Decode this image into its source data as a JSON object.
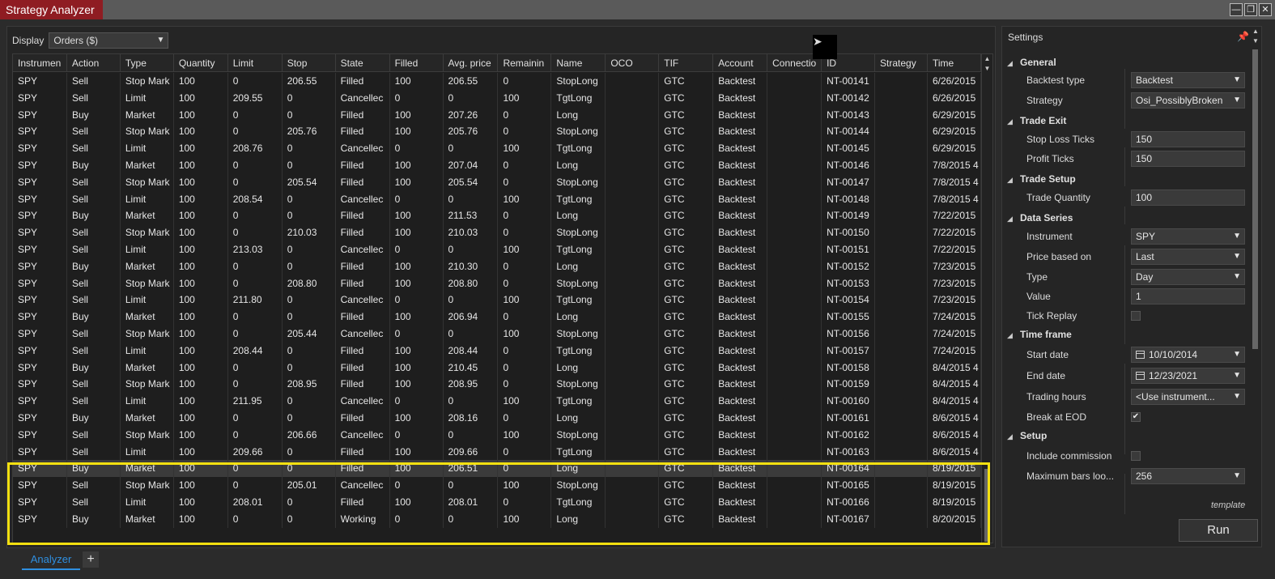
{
  "window": {
    "title": "Strategy Analyzer",
    "controls": {
      "minimize": "—",
      "restore": "❐",
      "close": "✕"
    }
  },
  "display": {
    "label": "Display",
    "selected": "Orders ($)"
  },
  "grid": {
    "columns": [
      "Instrumen",
      "Action",
      "Type",
      "Quantity",
      "Limit",
      "Stop",
      "State",
      "Filled",
      "Avg. price",
      "Remainin",
      "Name",
      "OCO",
      "TIF",
      "Account",
      "Connectio",
      "ID",
      "Strategy",
      "Time"
    ],
    "rows": [
      [
        "SPY",
        "Sell",
        "Stop Mark",
        "100",
        "0",
        "206.55",
        "Filled",
        "100",
        "206.55",
        "0",
        "StopLong",
        "",
        "GTC",
        "Backtest",
        "",
        "NT-00141",
        "",
        "6/26/2015"
      ],
      [
        "SPY",
        "Sell",
        "Limit",
        "100",
        "209.55",
        "0",
        "Cancellec",
        "0",
        "0",
        "100",
        "TgtLong",
        "",
        "GTC",
        "Backtest",
        "",
        "NT-00142",
        "",
        "6/26/2015"
      ],
      [
        "SPY",
        "Buy",
        "Market",
        "100",
        "0",
        "0",
        "Filled",
        "100",
        "207.26",
        "0",
        "Long",
        "",
        "GTC",
        "Backtest",
        "",
        "NT-00143",
        "",
        "6/29/2015"
      ],
      [
        "SPY",
        "Sell",
        "Stop Mark",
        "100",
        "0",
        "205.76",
        "Filled",
        "100",
        "205.76",
        "0",
        "StopLong",
        "",
        "GTC",
        "Backtest",
        "",
        "NT-00144",
        "",
        "6/29/2015"
      ],
      [
        "SPY",
        "Sell",
        "Limit",
        "100",
        "208.76",
        "0",
        "Cancellec",
        "0",
        "0",
        "100",
        "TgtLong",
        "",
        "GTC",
        "Backtest",
        "",
        "NT-00145",
        "",
        "6/29/2015"
      ],
      [
        "SPY",
        "Buy",
        "Market",
        "100",
        "0",
        "0",
        "Filled",
        "100",
        "207.04",
        "0",
        "Long",
        "",
        "GTC",
        "Backtest",
        "",
        "NT-00146",
        "",
        "7/8/2015 4"
      ],
      [
        "SPY",
        "Sell",
        "Stop Mark",
        "100",
        "0",
        "205.54",
        "Filled",
        "100",
        "205.54",
        "0",
        "StopLong",
        "",
        "GTC",
        "Backtest",
        "",
        "NT-00147",
        "",
        "7/8/2015 4"
      ],
      [
        "SPY",
        "Sell",
        "Limit",
        "100",
        "208.54",
        "0",
        "Cancellec",
        "0",
        "0",
        "100",
        "TgtLong",
        "",
        "GTC",
        "Backtest",
        "",
        "NT-00148",
        "",
        "7/8/2015 4"
      ],
      [
        "SPY",
        "Buy",
        "Market",
        "100",
        "0",
        "0",
        "Filled",
        "100",
        "211.53",
        "0",
        "Long",
        "",
        "GTC",
        "Backtest",
        "",
        "NT-00149",
        "",
        "7/22/2015"
      ],
      [
        "SPY",
        "Sell",
        "Stop Mark",
        "100",
        "0",
        "210.03",
        "Filled",
        "100",
        "210.03",
        "0",
        "StopLong",
        "",
        "GTC",
        "Backtest",
        "",
        "NT-00150",
        "",
        "7/22/2015"
      ],
      [
        "SPY",
        "Sell",
        "Limit",
        "100",
        "213.03",
        "0",
        "Cancellec",
        "0",
        "0",
        "100",
        "TgtLong",
        "",
        "GTC",
        "Backtest",
        "",
        "NT-00151",
        "",
        "7/22/2015"
      ],
      [
        "SPY",
        "Buy",
        "Market",
        "100",
        "0",
        "0",
        "Filled",
        "100",
        "210.30",
        "0",
        "Long",
        "",
        "GTC",
        "Backtest",
        "",
        "NT-00152",
        "",
        "7/23/2015"
      ],
      [
        "SPY",
        "Sell",
        "Stop Mark",
        "100",
        "0",
        "208.80",
        "Filled",
        "100",
        "208.80",
        "0",
        "StopLong",
        "",
        "GTC",
        "Backtest",
        "",
        "NT-00153",
        "",
        "7/23/2015"
      ],
      [
        "SPY",
        "Sell",
        "Limit",
        "100",
        "211.80",
        "0",
        "Cancellec",
        "0",
        "0",
        "100",
        "TgtLong",
        "",
        "GTC",
        "Backtest",
        "",
        "NT-00154",
        "",
        "7/23/2015"
      ],
      [
        "SPY",
        "Buy",
        "Market",
        "100",
        "0",
        "0",
        "Filled",
        "100",
        "206.94",
        "0",
        "Long",
        "",
        "GTC",
        "Backtest",
        "",
        "NT-00155",
        "",
        "7/24/2015"
      ],
      [
        "SPY",
        "Sell",
        "Stop Mark",
        "100",
        "0",
        "205.44",
        "Cancellec",
        "0",
        "0",
        "100",
        "StopLong",
        "",
        "GTC",
        "Backtest",
        "",
        "NT-00156",
        "",
        "7/24/2015"
      ],
      [
        "SPY",
        "Sell",
        "Limit",
        "100",
        "208.44",
        "0",
        "Filled",
        "100",
        "208.44",
        "0",
        "TgtLong",
        "",
        "GTC",
        "Backtest",
        "",
        "NT-00157",
        "",
        "7/24/2015"
      ],
      [
        "SPY",
        "Buy",
        "Market",
        "100",
        "0",
        "0",
        "Filled",
        "100",
        "210.45",
        "0",
        "Long",
        "",
        "GTC",
        "Backtest",
        "",
        "NT-00158",
        "",
        "8/4/2015 4"
      ],
      [
        "SPY",
        "Sell",
        "Stop Mark",
        "100",
        "0",
        "208.95",
        "Filled",
        "100",
        "208.95",
        "0",
        "StopLong",
        "",
        "GTC",
        "Backtest",
        "",
        "NT-00159",
        "",
        "8/4/2015 4"
      ],
      [
        "SPY",
        "Sell",
        "Limit",
        "100",
        "211.95",
        "0",
        "Cancellec",
        "0",
        "0",
        "100",
        "TgtLong",
        "",
        "GTC",
        "Backtest",
        "",
        "NT-00160",
        "",
        "8/4/2015 4"
      ],
      [
        "SPY",
        "Buy",
        "Market",
        "100",
        "0",
        "0",
        "Filled",
        "100",
        "208.16",
        "0",
        "Long",
        "",
        "GTC",
        "Backtest",
        "",
        "NT-00161",
        "",
        "8/6/2015 4"
      ],
      [
        "SPY",
        "Sell",
        "Stop Mark",
        "100",
        "0",
        "206.66",
        "Cancellec",
        "0",
        "0",
        "100",
        "StopLong",
        "",
        "GTC",
        "Backtest",
        "",
        "NT-00162",
        "",
        "8/6/2015 4"
      ],
      [
        "SPY",
        "Sell",
        "Limit",
        "100",
        "209.66",
        "0",
        "Filled",
        "100",
        "209.66",
        "0",
        "TgtLong",
        "",
        "GTC",
        "Backtest",
        "",
        "NT-00163",
        "",
        "8/6/2015 4"
      ],
      [
        "SPY",
        "Buy",
        "Market",
        "100",
        "0",
        "0",
        "Filled",
        "100",
        "206.51",
        "0",
        "Long",
        "",
        "GTC",
        "Backtest",
        "",
        "NT-00164",
        "",
        "8/19/2015"
      ],
      [
        "SPY",
        "Sell",
        "Stop Mark",
        "100",
        "0",
        "205.01",
        "Cancellec",
        "0",
        "0",
        "100",
        "StopLong",
        "",
        "GTC",
        "Backtest",
        "",
        "NT-00165",
        "",
        "8/19/2015"
      ],
      [
        "SPY",
        "Sell",
        "Limit",
        "100",
        "208.01",
        "0",
        "Filled",
        "100",
        "208.01",
        "0",
        "TgtLong",
        "",
        "GTC",
        "Backtest",
        "",
        "NT-00166",
        "",
        "8/19/2015"
      ],
      [
        "SPY",
        "Buy",
        "Market",
        "100",
        "0",
        "0",
        "Working",
        "0",
        "0",
        "100",
        "Long",
        "",
        "GTC",
        "Backtest",
        "",
        "NT-00167",
        "",
        "8/20/2015"
      ]
    ],
    "selected_row": 23,
    "highlight_color": "#f4e010"
  },
  "tabs": {
    "active": "Analyzer",
    "add": "+"
  },
  "settings": {
    "title": "Settings",
    "categories": {
      "general": "General",
      "trade_exit": "Trade Exit",
      "trade_setup": "Trade Setup",
      "data_series": "Data Series",
      "time_frame": "Time frame",
      "setup": "Setup"
    },
    "props": {
      "backtest_type": {
        "label": "Backtest type",
        "value": "Backtest"
      },
      "strategy": {
        "label": "Strategy",
        "value": "Osi_PossiblyBroken"
      },
      "stop_loss_ticks": {
        "label": "Stop Loss Ticks",
        "value": "150"
      },
      "profit_ticks": {
        "label": "Profit Ticks",
        "value": "150"
      },
      "trade_quantity": {
        "label": "Trade Quantity",
        "value": "100"
      },
      "instrument": {
        "label": "Instrument",
        "value": "SPY"
      },
      "price_based_on": {
        "label": "Price based on",
        "value": "Last"
      },
      "type": {
        "label": "Type",
        "value": "Day"
      },
      "value": {
        "label": "Value",
        "value": "1"
      },
      "tick_replay": {
        "label": "Tick Replay",
        "checked": false
      },
      "start_date": {
        "label": "Start date",
        "value": "10/10/2014"
      },
      "end_date": {
        "label": "End date",
        "value": "12/23/2021"
      },
      "trading_hours": {
        "label": "Trading hours",
        "value": "<Use instrument..."
      },
      "break_at_eod": {
        "label": "Break at EOD",
        "checked": true,
        "mark": "✔"
      },
      "include_commission": {
        "label": "Include commission",
        "checked": false
      },
      "max_bars_lookback": {
        "label": "Maximum bars loo...",
        "value": "256"
      }
    },
    "template_label": "template",
    "run_label": "Run"
  }
}
